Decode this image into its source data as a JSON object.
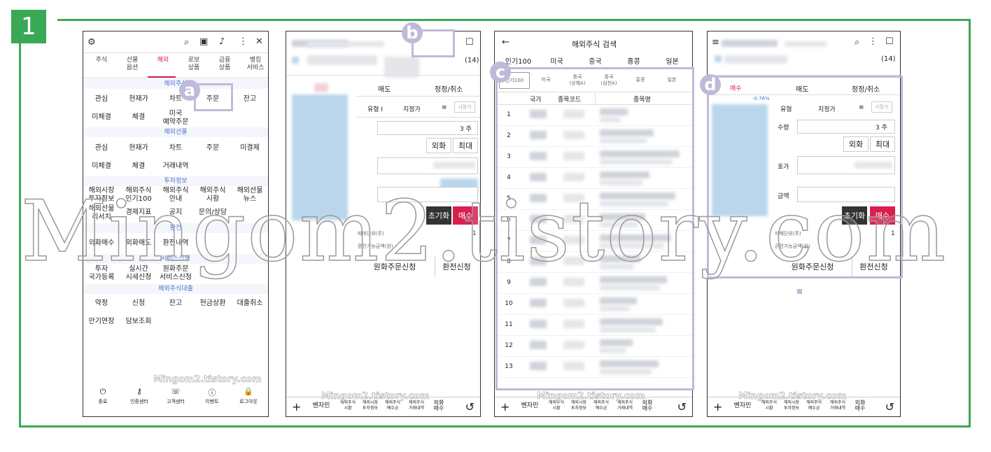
{
  "step_number": "1",
  "callouts": [
    "a",
    "b",
    "c",
    "d"
  ],
  "watermark": "Mingom2.tistory.com",
  "p1": {
    "tabs": [
      {
        "label": "주식"
      },
      {
        "label": "선물\n옵션"
      },
      {
        "label": "해외"
      },
      {
        "label": "로보\n상품"
      },
      {
        "label": "금융\n상품"
      },
      {
        "label": "뱅킹\n서비스"
      }
    ],
    "sections": {
      "s1": "해외주식",
      "s2": "해외선물",
      "s3": "투자정보",
      "s4": "환전",
      "s5": "서비스신청",
      "s6": "해외주식대출"
    },
    "stock": [
      "관심",
      "현재가",
      "차트",
      "주문",
      "잔고",
      "미체결",
      "체결",
      "미국\n예약주문"
    ],
    "futures": [
      "관심",
      "현재가",
      "차트",
      "주문",
      "미결제",
      "미체결",
      "체결",
      "거래내역"
    ],
    "info": [
      "해외시장\n투자정보",
      "해외주식\n인기100",
      "해외주식\n안내",
      "해외주식\n시황",
      "해외선물\n뉴스",
      "해외선물\n리서치",
      "경제지표",
      "공지",
      "문의/상담"
    ],
    "fx": [
      "외화매수",
      "외화매도",
      "환전내역"
    ],
    "service": [
      "투자\n국가등록",
      "실시간\n시세신청",
      "원화주문\n서비스신청"
    ],
    "loan": [
      "약정",
      "신청",
      "잔고",
      "현금상환",
      "대출취소",
      "만기연장",
      "담보조회"
    ],
    "bottom": [
      "종료",
      "인증센터",
      "고객센터",
      "이벤트",
      "로그아웃"
    ]
  },
  "p2": {
    "count": "(14)",
    "tabs": {
      "sell": "매도",
      "modify": "정정/취소"
    },
    "order_type": "지정가",
    "qty": "3 주",
    "fx_btn": "외화",
    "max_btn": "최대",
    "reset": "초기화",
    "buy": "매수",
    "unit_label": "매매단위(주)",
    "unit_value": "1",
    "fx_amount_label": "환전가능금액(원)",
    "krw_order": "원화주문신청",
    "exchange": "환전신청"
  },
  "p3": {
    "title": "해외주식 검색",
    "main_tabs": [
      "인기100",
      "미국",
      "중국",
      "홍콩",
      "일본"
    ],
    "sub_tabs": [
      "인기100",
      "미국",
      "중국\n(상해A)",
      "중국\n(심천A)",
      "홍콩",
      "일본"
    ],
    "headers": {
      "country": "국가",
      "code": "종목코드",
      "name": "종목명"
    },
    "rows": [
      "1",
      "2",
      "3",
      "4",
      "5",
      "6",
      "7",
      "8",
      "9",
      "10",
      "11",
      "12",
      "13"
    ]
  },
  "p4": {
    "count": "(14)",
    "tabs": {
      "buy": "매수",
      "sell": "매도",
      "modify": "정정/취소"
    },
    "pct": "-0.76%",
    "type_label": "유형",
    "order_type": "지정가",
    "qty_label": "수량",
    "qty": "3 주",
    "fx_btn": "외화",
    "max_btn": "최대",
    "price_label": "호가",
    "amount_label": "금액",
    "reset": "초기화",
    "buy": "매수",
    "unit_label": "매매단위(주)",
    "unit_value": "1",
    "fx_amount_label": "환전가능금액(원)",
    "krw_order": "원화주문신청",
    "exchange": "환전신청"
  },
  "bottom_nav": [
    "벤자민",
    "해외주식\n시황",
    "해외시장\n투자정보",
    "해외주식\n예수금",
    "해외주식\n거래내역",
    "외화\n매수"
  ]
}
